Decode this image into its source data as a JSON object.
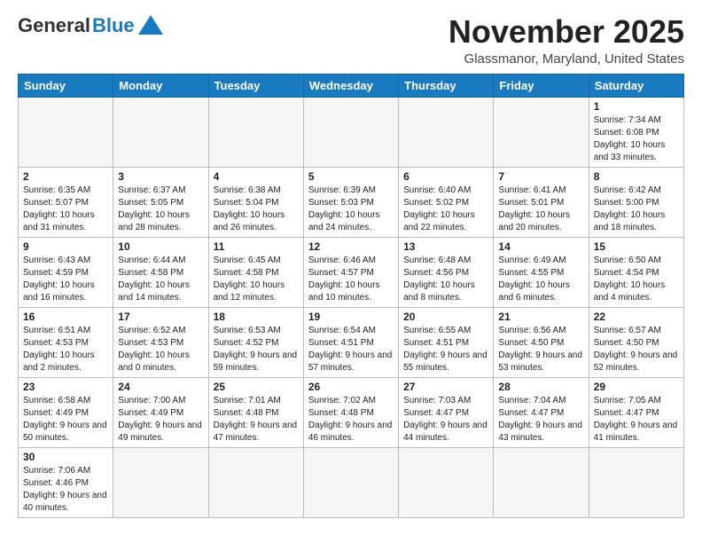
{
  "header": {
    "logo": {
      "general": "General",
      "blue": "Blue"
    },
    "title": "November 2025",
    "location": "Glassmanor, Maryland, United States"
  },
  "days_of_week": [
    "Sunday",
    "Monday",
    "Tuesday",
    "Wednesday",
    "Thursday",
    "Friday",
    "Saturday"
  ],
  "weeks": [
    [
      {
        "day": "",
        "info": ""
      },
      {
        "day": "",
        "info": ""
      },
      {
        "day": "",
        "info": ""
      },
      {
        "day": "",
        "info": ""
      },
      {
        "day": "",
        "info": ""
      },
      {
        "day": "",
        "info": ""
      },
      {
        "day": "1",
        "info": "Sunrise: 7:34 AM\nSunset: 6:08 PM\nDaylight: 10 hours and 33 minutes."
      }
    ],
    [
      {
        "day": "2",
        "info": "Sunrise: 6:35 AM\nSunset: 5:07 PM\nDaylight: 10 hours and 31 minutes."
      },
      {
        "day": "3",
        "info": "Sunrise: 6:37 AM\nSunset: 5:05 PM\nDaylight: 10 hours and 28 minutes."
      },
      {
        "day": "4",
        "info": "Sunrise: 6:38 AM\nSunset: 5:04 PM\nDaylight: 10 hours and 26 minutes."
      },
      {
        "day": "5",
        "info": "Sunrise: 6:39 AM\nSunset: 5:03 PM\nDaylight: 10 hours and 24 minutes."
      },
      {
        "day": "6",
        "info": "Sunrise: 6:40 AM\nSunset: 5:02 PM\nDaylight: 10 hours and 22 minutes."
      },
      {
        "day": "7",
        "info": "Sunrise: 6:41 AM\nSunset: 5:01 PM\nDaylight: 10 hours and 20 minutes."
      },
      {
        "day": "8",
        "info": "Sunrise: 6:42 AM\nSunset: 5:00 PM\nDaylight: 10 hours and 18 minutes."
      }
    ],
    [
      {
        "day": "9",
        "info": "Sunrise: 6:43 AM\nSunset: 4:59 PM\nDaylight: 10 hours and 16 minutes."
      },
      {
        "day": "10",
        "info": "Sunrise: 6:44 AM\nSunset: 4:58 PM\nDaylight: 10 hours and 14 minutes."
      },
      {
        "day": "11",
        "info": "Sunrise: 6:45 AM\nSunset: 4:58 PM\nDaylight: 10 hours and 12 minutes."
      },
      {
        "day": "12",
        "info": "Sunrise: 6:46 AM\nSunset: 4:57 PM\nDaylight: 10 hours and 10 minutes."
      },
      {
        "day": "13",
        "info": "Sunrise: 6:48 AM\nSunset: 4:56 PM\nDaylight: 10 hours and 8 minutes."
      },
      {
        "day": "14",
        "info": "Sunrise: 6:49 AM\nSunset: 4:55 PM\nDaylight: 10 hours and 6 minutes."
      },
      {
        "day": "15",
        "info": "Sunrise: 6:50 AM\nSunset: 4:54 PM\nDaylight: 10 hours and 4 minutes."
      }
    ],
    [
      {
        "day": "16",
        "info": "Sunrise: 6:51 AM\nSunset: 4:53 PM\nDaylight: 10 hours and 2 minutes."
      },
      {
        "day": "17",
        "info": "Sunrise: 6:52 AM\nSunset: 4:53 PM\nDaylight: 10 hours and 0 minutes."
      },
      {
        "day": "18",
        "info": "Sunrise: 6:53 AM\nSunset: 4:52 PM\nDaylight: 9 hours and 59 minutes."
      },
      {
        "day": "19",
        "info": "Sunrise: 6:54 AM\nSunset: 4:51 PM\nDaylight: 9 hours and 57 minutes."
      },
      {
        "day": "20",
        "info": "Sunrise: 6:55 AM\nSunset: 4:51 PM\nDaylight: 9 hours and 55 minutes."
      },
      {
        "day": "21",
        "info": "Sunrise: 6:56 AM\nSunset: 4:50 PM\nDaylight: 9 hours and 53 minutes."
      },
      {
        "day": "22",
        "info": "Sunrise: 6:57 AM\nSunset: 4:50 PM\nDaylight: 9 hours and 52 minutes."
      }
    ],
    [
      {
        "day": "23",
        "info": "Sunrise: 6:58 AM\nSunset: 4:49 PM\nDaylight: 9 hours and 50 minutes."
      },
      {
        "day": "24",
        "info": "Sunrise: 7:00 AM\nSunset: 4:49 PM\nDaylight: 9 hours and 49 minutes."
      },
      {
        "day": "25",
        "info": "Sunrise: 7:01 AM\nSunset: 4:48 PM\nDaylight: 9 hours and 47 minutes."
      },
      {
        "day": "26",
        "info": "Sunrise: 7:02 AM\nSunset: 4:48 PM\nDaylight: 9 hours and 46 minutes."
      },
      {
        "day": "27",
        "info": "Sunrise: 7:03 AM\nSunset: 4:47 PM\nDaylight: 9 hours and 44 minutes."
      },
      {
        "day": "28",
        "info": "Sunrise: 7:04 AM\nSunset: 4:47 PM\nDaylight: 9 hours and 43 minutes."
      },
      {
        "day": "29",
        "info": "Sunrise: 7:05 AM\nSunset: 4:47 PM\nDaylight: 9 hours and 41 minutes."
      }
    ],
    [
      {
        "day": "30",
        "info": "Sunrise: 7:06 AM\nSunset: 4:46 PM\nDaylight: 9 hours and 40 minutes."
      },
      {
        "day": "",
        "info": ""
      },
      {
        "day": "",
        "info": ""
      },
      {
        "day": "",
        "info": ""
      },
      {
        "day": "",
        "info": ""
      },
      {
        "day": "",
        "info": ""
      },
      {
        "day": "",
        "info": ""
      }
    ]
  ]
}
